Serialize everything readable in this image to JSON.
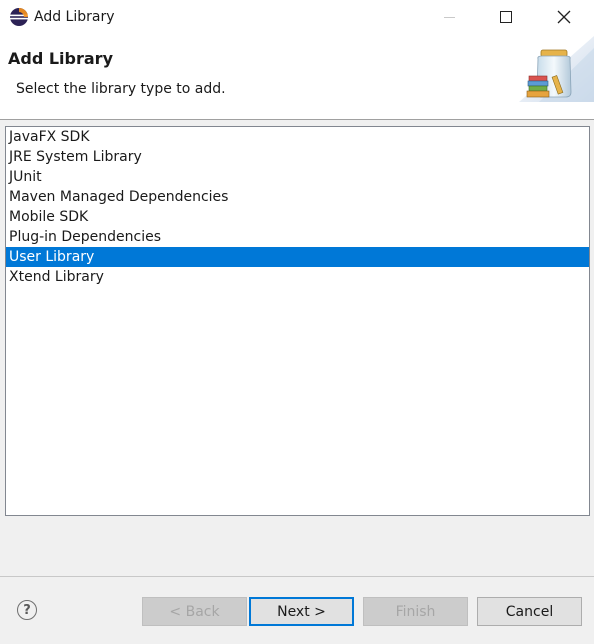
{
  "window": {
    "title": "Add Library",
    "icon": "eclipse-icon",
    "controls": [
      "minimize-icon",
      "maximize-icon",
      "close-icon"
    ]
  },
  "header": {
    "title": "Add Library",
    "description": "Select the library type to add.",
    "image": "library-jar-icon"
  },
  "library_types": {
    "items": [
      "JavaFX SDK",
      "JRE System Library",
      "JUnit",
      "Maven Managed Dependencies",
      "Mobile SDK",
      "Plug-in Dependencies",
      "User Library",
      "Xtend Library"
    ],
    "selected": "User Library",
    "selection_color": "#0078d7"
  },
  "buttons": {
    "help": "?",
    "back": "< Back",
    "next": "Next >",
    "finish": "Finish",
    "cancel": "Cancel",
    "back_enabled": false,
    "finish_enabled": false
  }
}
